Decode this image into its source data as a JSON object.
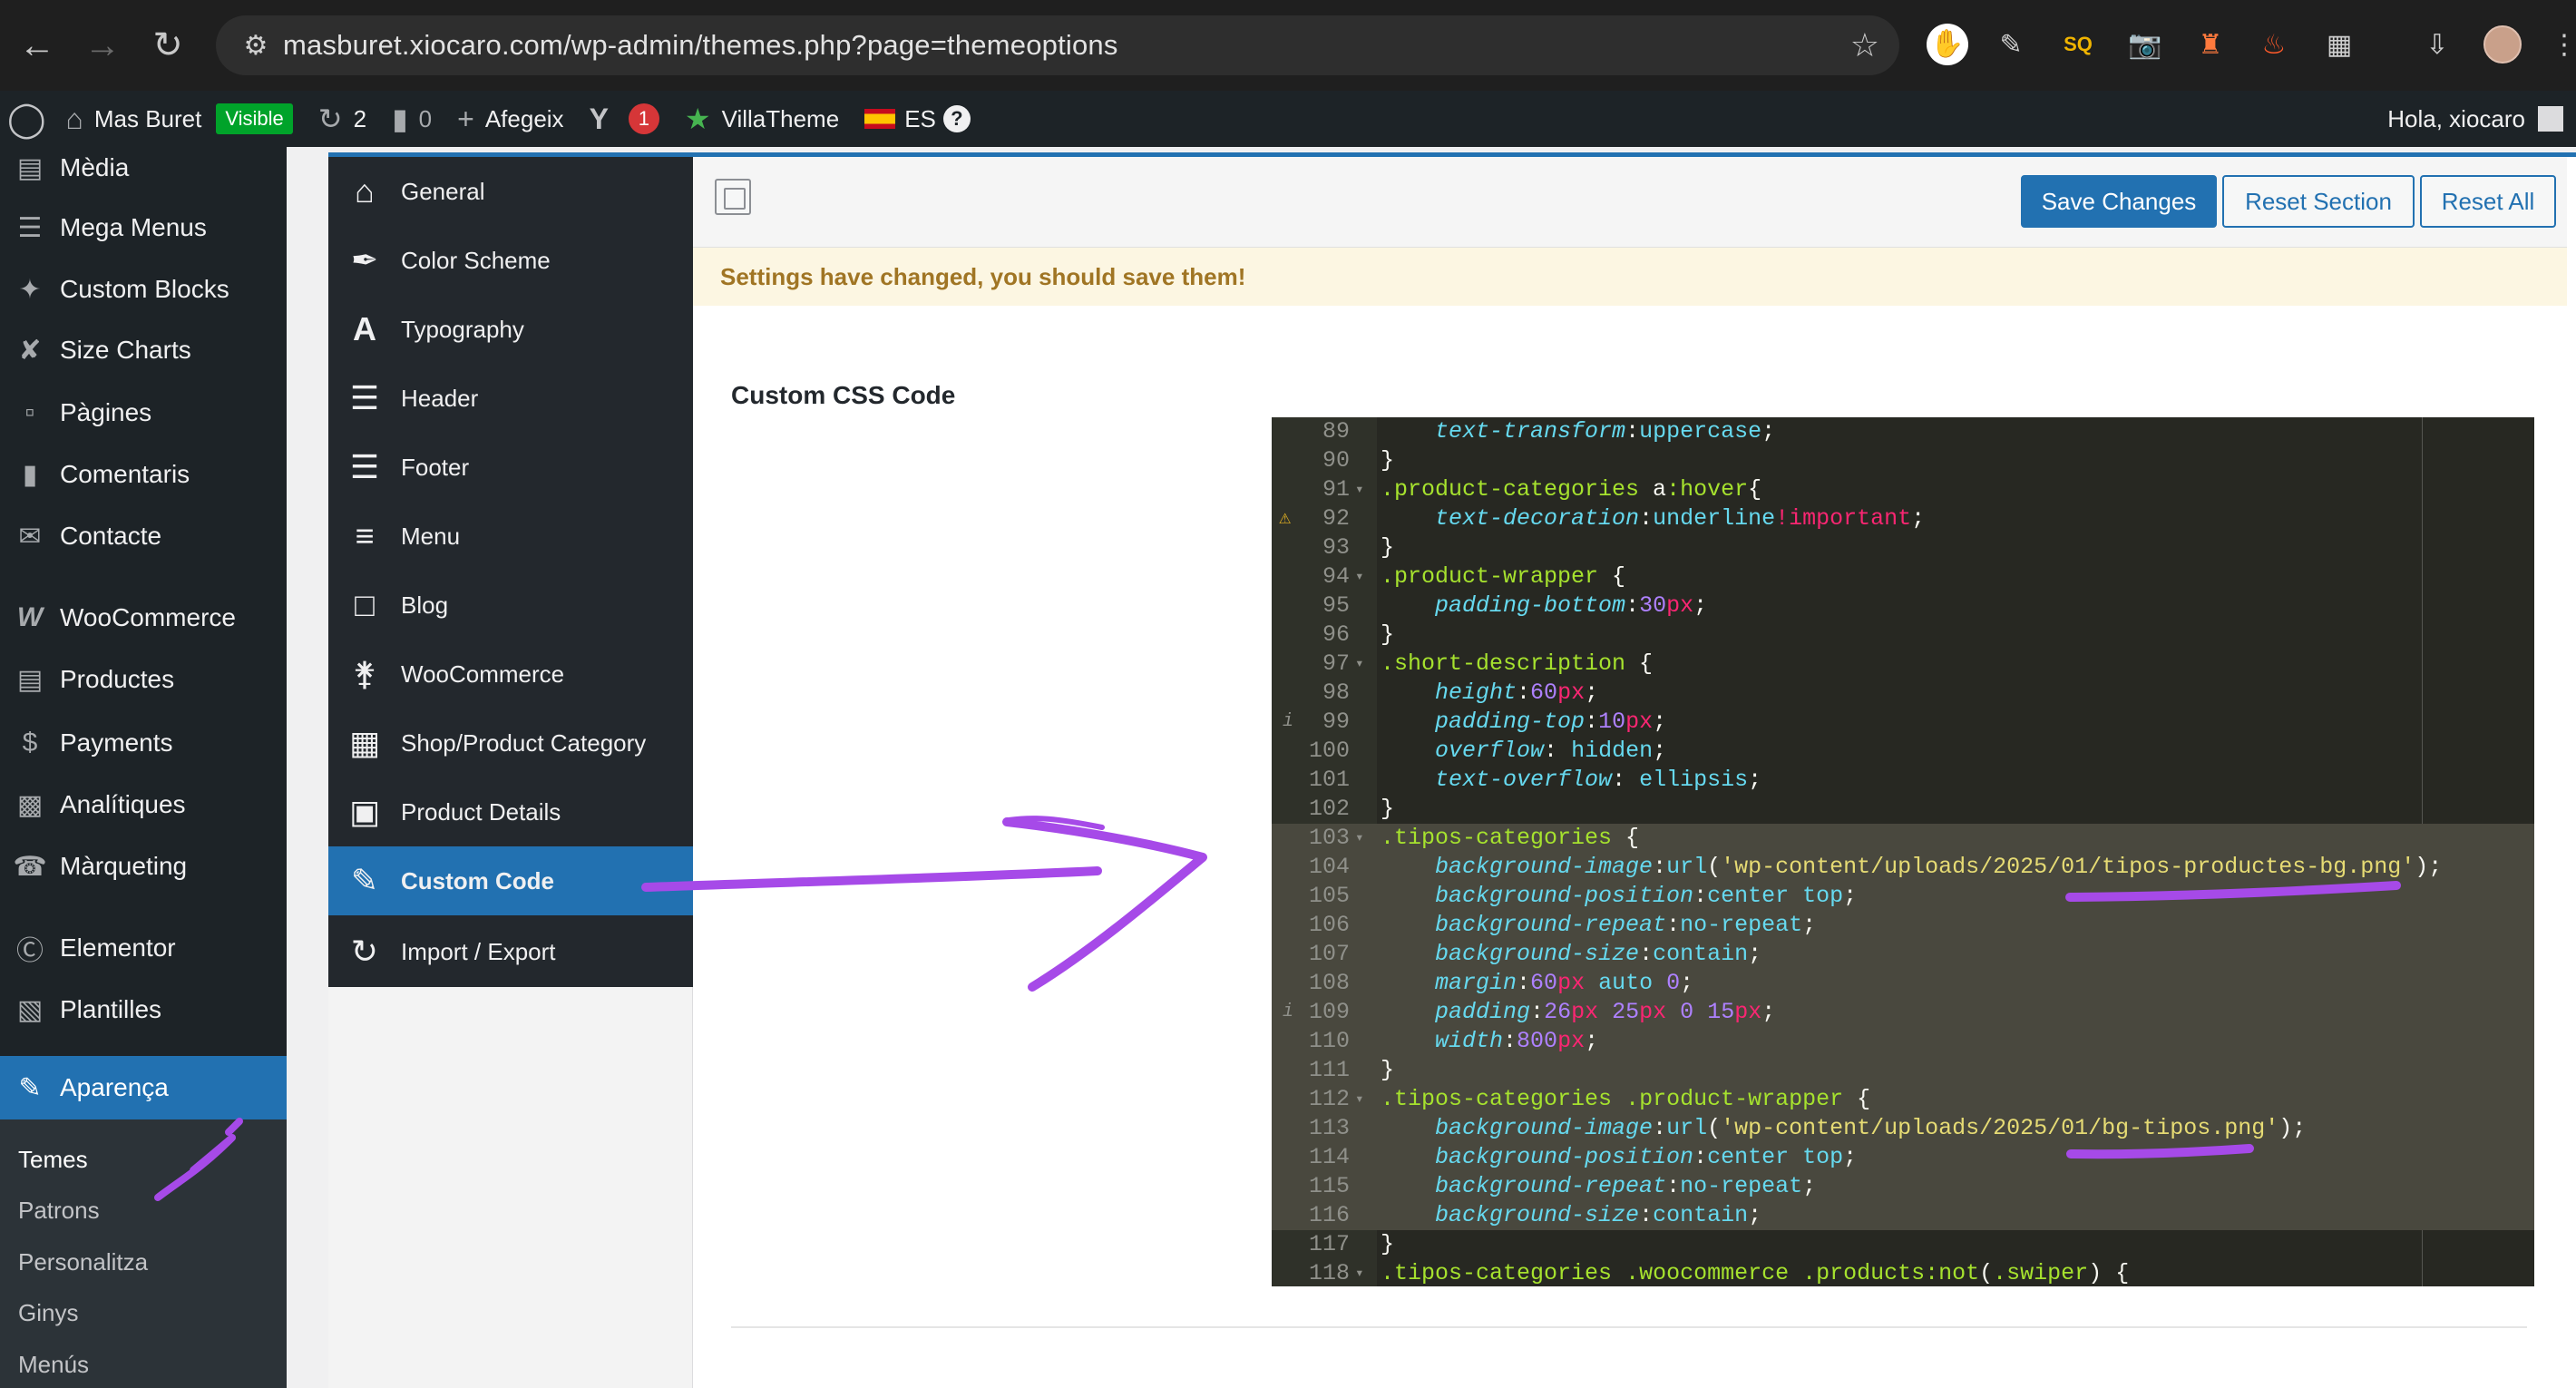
{
  "browser": {
    "url": "masburet.xiocaro.com/wp-admin/themes.php?page=themeoptions",
    "back_icon": "arrow-left-icon",
    "forward_icon": "arrow-right-icon",
    "reload_icon": "reload-icon"
  },
  "adminbar": {
    "site_name": "Mas Buret",
    "visibility": "Visible",
    "updates_count": "2",
    "comments_count": "0",
    "new_label": "Afegeix",
    "yoast_count": "1",
    "villatheme_label": "VillaTheme",
    "language_label": "ES",
    "greeting": "Hola, xiocaro"
  },
  "adminmenu": {
    "items": [
      {
        "label": "Mèdia",
        "icon": "media-icon"
      },
      {
        "label": "Mega Menus",
        "icon": "menu-icon"
      },
      {
        "label": "Custom Blocks",
        "icon": "pin-icon"
      },
      {
        "label": "Size Charts",
        "icon": "tools-icon"
      },
      {
        "label": "Pàgines",
        "icon": "pages-icon"
      },
      {
        "label": "Comentaris",
        "icon": "comments-icon"
      },
      {
        "label": "Contacte",
        "icon": "mail-icon"
      },
      {
        "label": "WooCommerce",
        "icon": "woocommerce-icon"
      },
      {
        "label": "Productes",
        "icon": "archive-icon"
      },
      {
        "label": "Payments",
        "icon": "payments-icon"
      },
      {
        "label": "Analítiques",
        "icon": "chart-icon"
      },
      {
        "label": "Màrqueting",
        "icon": "megaphone-icon"
      },
      {
        "label": "Elementor",
        "icon": "elementor-icon"
      },
      {
        "label": "Plantilles",
        "icon": "folder-icon"
      },
      {
        "label": "Aparença",
        "icon": "appearance-icon"
      }
    ],
    "submenu": [
      "Temes",
      "Patrons",
      "Personalitza",
      "Ginys",
      "Menús"
    ]
  },
  "redux": {
    "sections": [
      {
        "label": "General",
        "icon": "home-icon"
      },
      {
        "label": "Color Scheme",
        "icon": "brush-icon"
      },
      {
        "label": "Typography",
        "icon": "typography-icon"
      },
      {
        "label": "Header",
        "icon": "lines-icon"
      },
      {
        "label": "Footer",
        "icon": "lines-icon"
      },
      {
        "label": "Menu",
        "icon": "list-icon"
      },
      {
        "label": "Blog",
        "icon": "blog-icon"
      },
      {
        "label": "WooCommerce",
        "icon": "cart-icon"
      },
      {
        "label": "Shop/Product Category",
        "icon": "grid-icon"
      },
      {
        "label": "Product Details",
        "icon": "clipboard-icon"
      },
      {
        "label": "Custom Code",
        "icon": "edit-icon"
      },
      {
        "label": "Import / Export",
        "icon": "refresh-icon"
      }
    ],
    "buttons": {
      "save": "Save Changes",
      "reset_section": "Reset Section",
      "reset_all": "Reset All"
    },
    "notice": "Settings have changed, you should save them!",
    "field_label": "Custom CSS Code"
  },
  "editor": {
    "lines": [
      {
        "n": "89",
        "text": "    text-transform:uppercase;"
      },
      {
        "n": "90",
        "text": "}"
      },
      {
        "n": "91",
        "text": ".product-categories a:hover{"
      },
      {
        "n": "92",
        "text": "    text-decoration:underline!important;"
      },
      {
        "n": "93",
        "text": "}"
      },
      {
        "n": "94",
        "text": ".product-wrapper {"
      },
      {
        "n": "95",
        "text": "    padding-bottom:30px;"
      },
      {
        "n": "96",
        "text": "}"
      },
      {
        "n": "97",
        "text": ".short-description {"
      },
      {
        "n": "98",
        "text": "    height:60px;"
      },
      {
        "n": "99",
        "text": "    padding-top:10px;"
      },
      {
        "n": "100",
        "text": "    overflow: hidden;"
      },
      {
        "n": "101",
        "text": "    text-overflow: ellipsis;"
      },
      {
        "n": "102",
        "text": "}"
      },
      {
        "n": "103",
        "text": ".tipos-categories {"
      },
      {
        "n": "104",
        "text": "    background-image:url('wp-content/uploads/2025/01/tipos-productes-bg.png');"
      },
      {
        "n": "105",
        "text": "    background-position:center top;"
      },
      {
        "n": "106",
        "text": "    background-repeat:no-repeat;"
      },
      {
        "n": "107",
        "text": "    background-size:contain;"
      },
      {
        "n": "108",
        "text": "    margin:60px auto 0;"
      },
      {
        "n": "109",
        "text": "    padding:26px 25px 0 15px;"
      },
      {
        "n": "110",
        "text": "    width:800px;"
      },
      {
        "n": "111",
        "text": "}"
      },
      {
        "n": "112",
        "text": ".tipos-categories .product-wrapper {"
      },
      {
        "n": "113",
        "text": "    background-image:url('wp-content/uploads/2025/01/bg-tipos.png');"
      },
      {
        "n": "114",
        "text": "    background-position:center top;"
      },
      {
        "n": "115",
        "text": "    background-repeat:no-repeat;"
      },
      {
        "n": "116",
        "text": "    background-size:contain;"
      },
      {
        "n": "117",
        "text": "}"
      },
      {
        "n": "118",
        "text": ".tipos-categories .woocommerce .products:not(.swiper) {"
      }
    ]
  },
  "colors": {
    "accent": "#2271b1",
    "annotation": "#a64ae8",
    "editor_bg": "#272822"
  }
}
